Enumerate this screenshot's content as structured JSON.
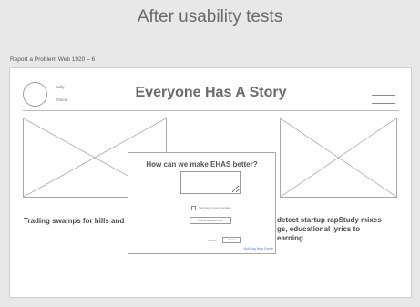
{
  "page_title": "After usability tests",
  "artboard_label": "Report a Problem Web 1920 – 6",
  "header": {
    "user_name": "Sally",
    "user_city": "Ithaca",
    "site_title": "Everyone Has A Story",
    "menu_icon": "hamburger-menu-icon"
  },
  "stories": [
    {
      "title": "Trading swamps for hills and"
    },
    {
      "title": "detect startup rapStudy mixes gs, educational lyrics to earning"
    }
  ],
  "modal": {
    "title": "How can we make EHAS better?",
    "feedback_placeholder": "",
    "checkbox_label": "Send logs (recommended)",
    "screenshot_button": "Add screenshot tool",
    "cancel_label": "Cancel",
    "send_button": "Send",
    "help_link": "Visit Bug Help Center"
  },
  "colors": {
    "background": "#e8e8e8",
    "artboard": "#ffffff",
    "link": "#4a7bd0",
    "wireframe_line": "#aaaaaa"
  }
}
